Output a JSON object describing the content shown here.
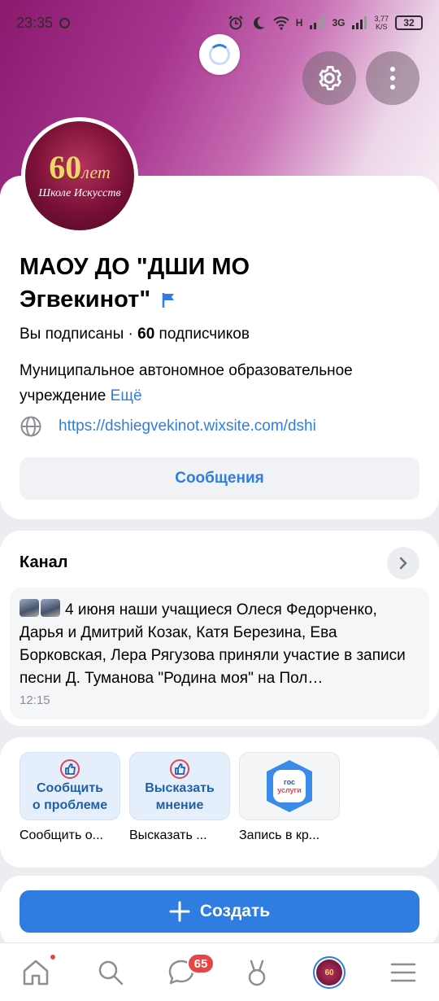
{
  "status_bar": {
    "time": "23:35",
    "network_h": "H",
    "network_3g": "3G",
    "speed_value": "3,77",
    "speed_unit": "K/S",
    "battery": "32"
  },
  "profile": {
    "avatar_badge": "60",
    "avatar_badge_suffix": "лет",
    "avatar_caption": "Школе Искусств",
    "name": "МАОУ ДО \"ДШИ МО Эгвекинот\"",
    "subscribed_text": "Вы подписаны · ",
    "subscribers_count": "60",
    "subscribers_label": " подписчиков",
    "description": "Муниципальное автономное образовательное учреждение",
    "more_label": "Ещё",
    "website": "https://dshiegvekinot.wixsite.com/dshi",
    "messages_button": "Сообщения"
  },
  "channel": {
    "title": "Канал",
    "post_text": "4 июня наши учащиеся Олеся Федорченко, Дарья и Дмитрий Козак, Катя Березина, Ева Борковская, Лера Рягузова приняли участие в записи песни Д. Туманова \"Родина моя\" на Пол…",
    "post_time": "12:15"
  },
  "services": [
    {
      "tile_line1": "Сообщить",
      "tile_line2": "о проблеме",
      "caption": "Сообщить о..."
    },
    {
      "tile_line1": "Высказать",
      "tile_line2": "мнение",
      "caption": "Высказать ..."
    },
    {
      "tile_line1": "гос",
      "tile_line2": "услуги",
      "caption": "Запись в кр..."
    }
  ],
  "create_button": "Создать",
  "tabbar": {
    "messages_badge": "65",
    "avatar_tab_text": "60"
  },
  "colors": {
    "accent": "#2f7de0",
    "badge": "#e64646"
  }
}
